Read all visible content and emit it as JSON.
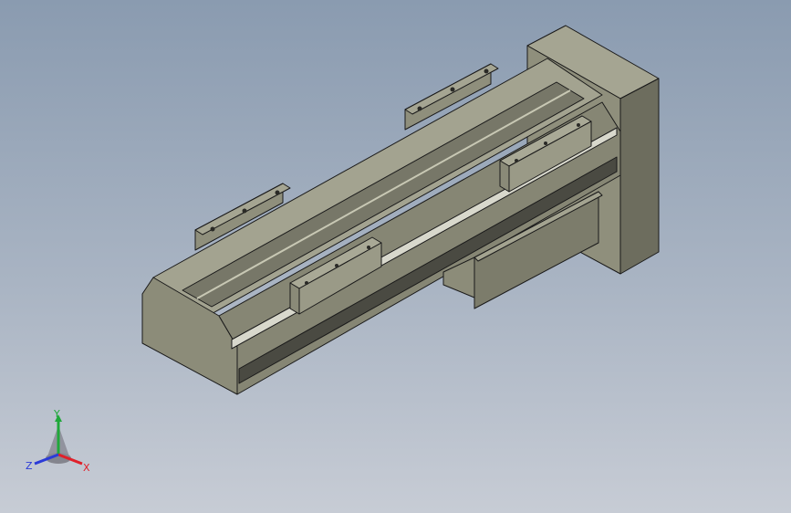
{
  "viewport": {
    "background_top": "#8a9bb0",
    "background_bottom": "#c7ccd5"
  },
  "model": {
    "body_color": "#9b9b88",
    "edge_color": "#1a1a1a"
  },
  "triad": {
    "x_label": "X",
    "y_label": "Y",
    "z_label": "Z",
    "x_color": "#e0202a",
    "y_color": "#1fa83a",
    "z_color": "#2a3ad8"
  }
}
